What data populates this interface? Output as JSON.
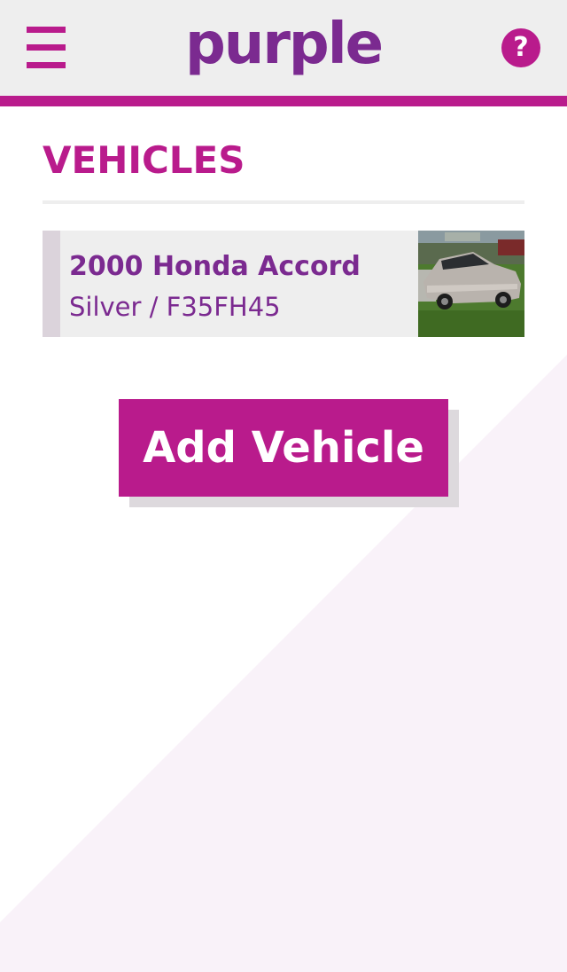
{
  "header": {
    "logo_text": "purple",
    "menu_icon": "hamburger-menu-icon",
    "help_icon": "help-question-icon",
    "help_glyph": "?"
  },
  "page": {
    "title": "VEHICLES"
  },
  "vehicles": [
    {
      "name": "2000 Honda Accord",
      "details": "Silver / F35FH45",
      "photo": "silver-sedan-photo"
    }
  ],
  "actions": {
    "add_vehicle_label": "Add Vehicle"
  },
  "colors": {
    "brand_magenta": "#b91b8c",
    "brand_purple": "#7b2a90",
    "header_bg": "#eeeeee",
    "card_bg": "#eeeeee",
    "background_tint": "#f9f2f9"
  }
}
